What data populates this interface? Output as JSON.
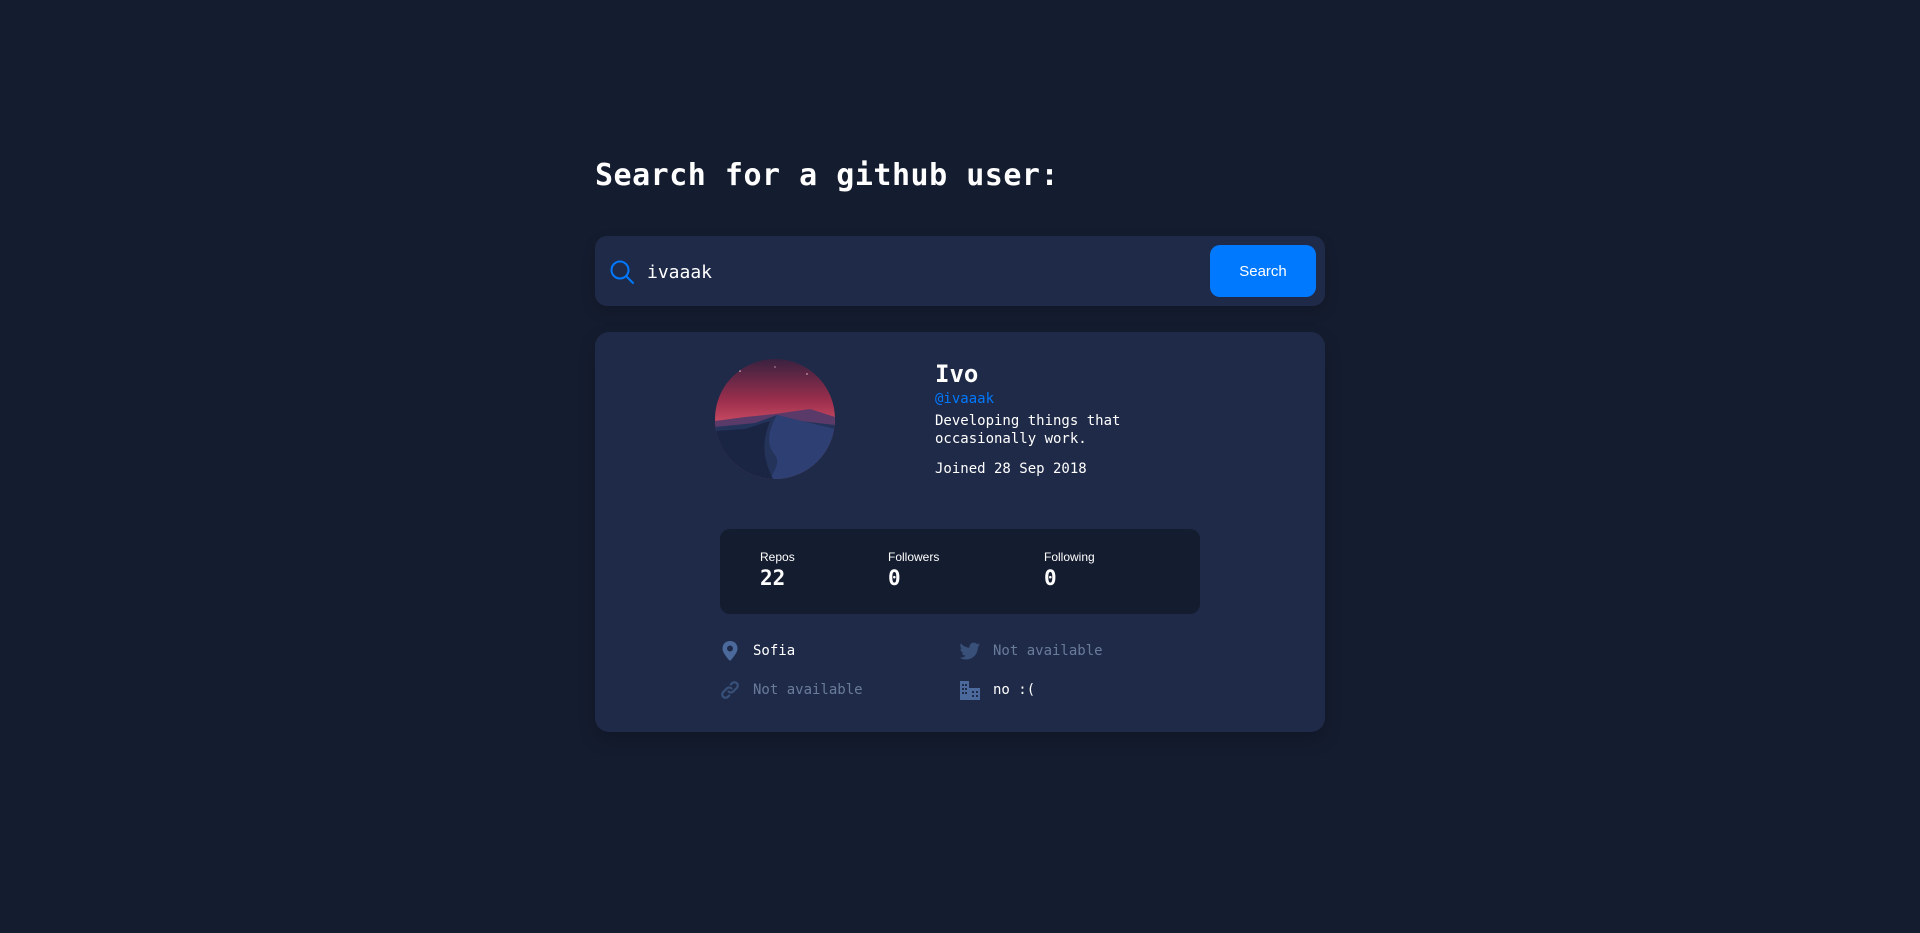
{
  "page": {
    "heading": "Search for a github user:"
  },
  "search": {
    "value": "ivaaak",
    "placeholder": "",
    "button_label": "Search",
    "icon": "search-icon"
  },
  "profile": {
    "name": "Ivo",
    "login": "@ivaaak",
    "bio": "Developing things that occasionally work.",
    "joined": "Joined 28 Sep 2018",
    "avatar": "avatar-dusk-landscape"
  },
  "stats": {
    "repos_label": "Repos",
    "repos_value": "22",
    "followers_label": "Followers",
    "followers_value": "0",
    "following_label": "Following",
    "following_value": "0"
  },
  "info": {
    "location": "Sofia",
    "twitter": "Not available",
    "blog": "Not available",
    "company": "no :("
  },
  "colors": {
    "background": "#141c2f",
    "card": "#1f2a48",
    "accent": "#0079ff",
    "muted": "#697c9a",
    "icon": "#4b6a9b"
  }
}
